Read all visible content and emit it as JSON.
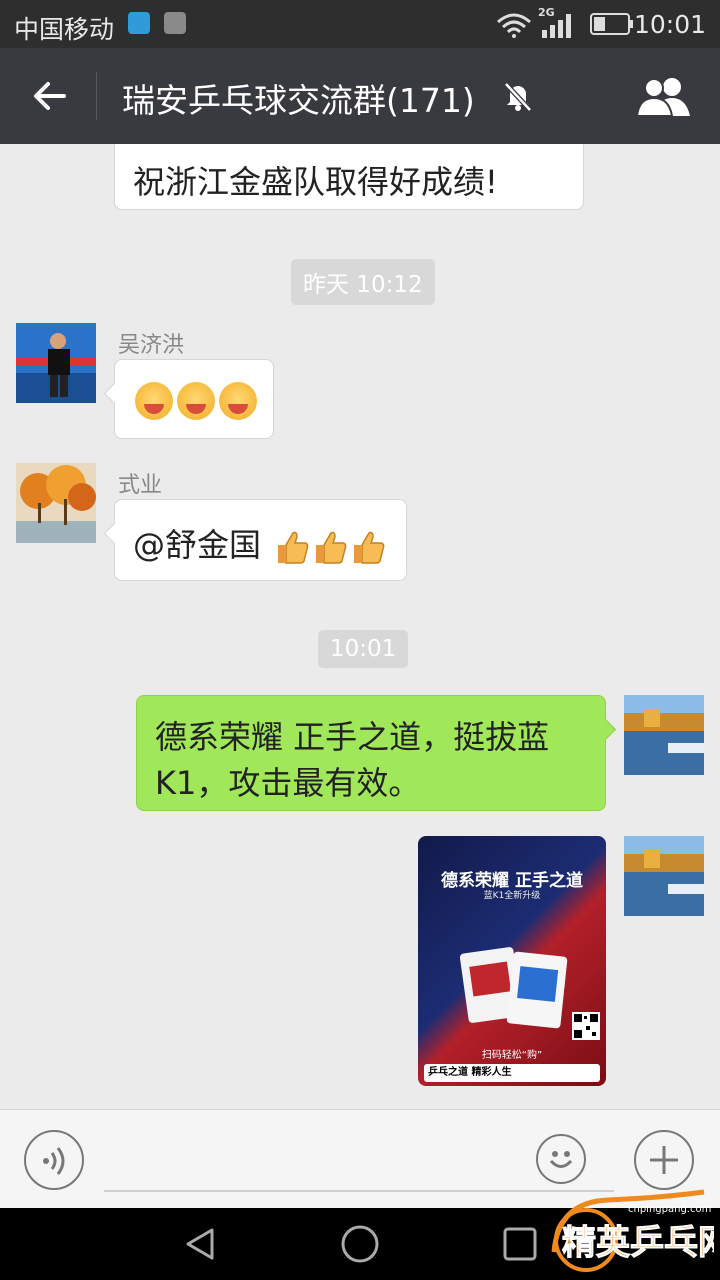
{
  "status_bar": {
    "carrier": "中国移动",
    "network": "2G",
    "time": "10:01"
  },
  "header": {
    "title": "瑞安乒乓球交流群(171)"
  },
  "messages": [
    {
      "type": "text",
      "side": "left",
      "text": "祝浙江金盛队取得好成绩!"
    },
    {
      "type": "time",
      "text": "昨天 10:12"
    },
    {
      "type": "emoji",
      "side": "left",
      "sender": "吴济洪",
      "emoji": "grin-blush-emoji",
      "count": 3
    },
    {
      "type": "mention",
      "side": "left",
      "sender": "式业",
      "text": "@舒金国",
      "emoji": "thumbs-up-icon",
      "count": 3
    },
    {
      "type": "time",
      "text": "10:01"
    },
    {
      "type": "text",
      "side": "right",
      "line1": "德系荣耀 正手之道，挺拔蓝",
      "line2": "K1，攻击最有效。"
    },
    {
      "type": "image",
      "side": "right",
      "poster_title": "德系荣耀 正手之道",
      "poster_sub": "蓝K1全新升级",
      "poster_scan": "扫码轻松“购”",
      "poster_footer": "乒乓之道 精彩人生"
    }
  ],
  "watermark": {
    "text": "精英乒乓网",
    "url": "cnpingpang.com"
  },
  "colors": {
    "title_bar": "#393a3f",
    "self_bubble": "#a0e75a",
    "chat_bg": "#ebebeb"
  }
}
